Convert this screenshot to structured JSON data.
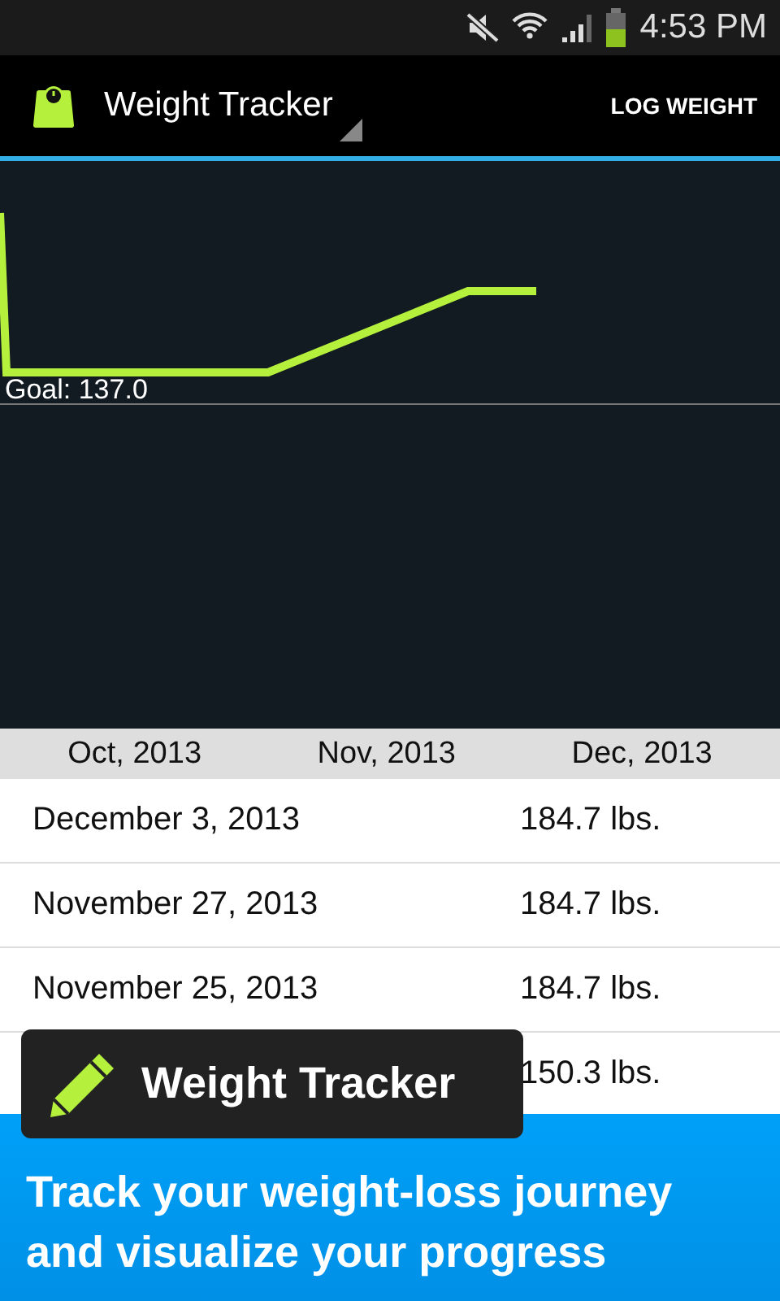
{
  "status_bar": {
    "time": "4:53 PM"
  },
  "action_bar": {
    "title": "Weight Tracker",
    "action": "LOG WEIGHT"
  },
  "chart": {
    "goal_label": "Goal: 137.0",
    "x_labels": [
      "Oct, 2013",
      "Nov, 2013",
      "Dec, 2013"
    ]
  },
  "entries": [
    {
      "date": "December 3, 2013",
      "weight": "184.7 lbs."
    },
    {
      "date": "November 27, 2013",
      "weight": "184.7 lbs."
    },
    {
      "date": "November 25, 2013",
      "weight": "184.7 lbs."
    },
    {
      "weight": "150.3 lbs."
    }
  ],
  "promo": {
    "app_name": "Weight Tracker",
    "tagline": "Track your weight-loss journey and visualize your progress"
  }
}
